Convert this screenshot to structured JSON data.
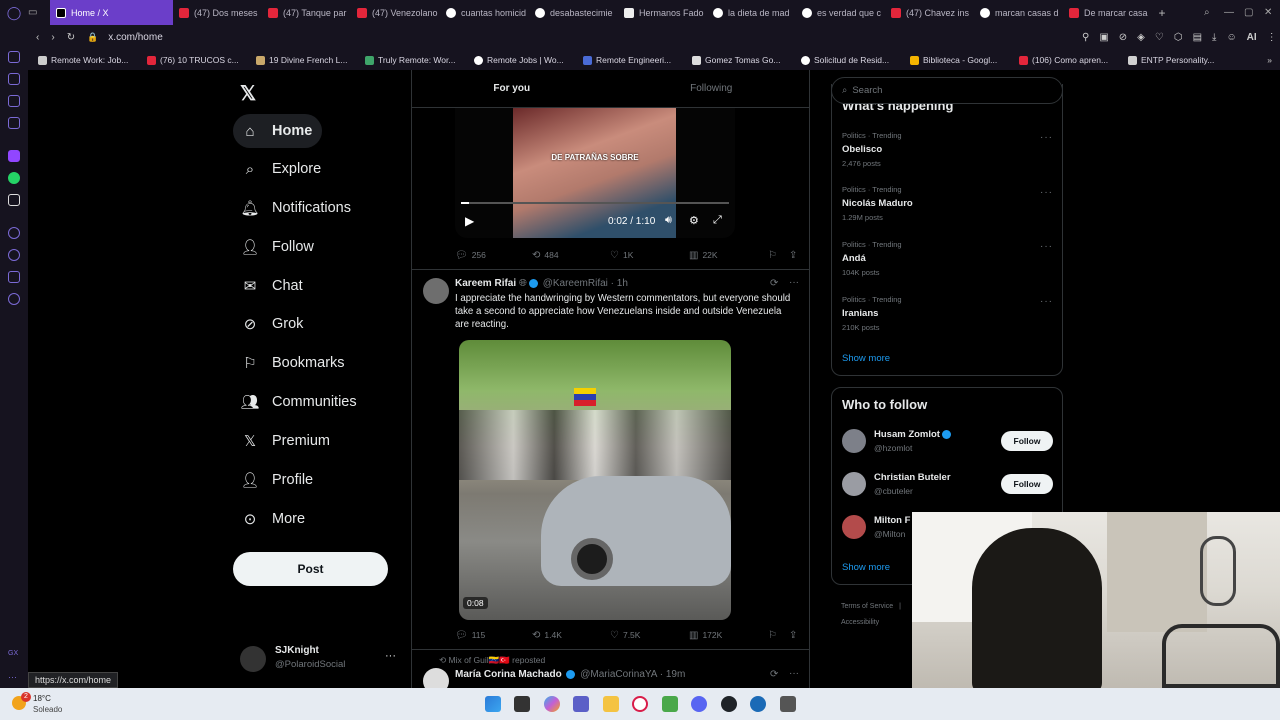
{
  "browser": {
    "tabs": [
      {
        "label": "Home / X",
        "favicon": "x"
      },
      {
        "label": "(47) Dos meses",
        "favicon": "yt"
      },
      {
        "label": "(47) Tanque par",
        "favicon": "yt"
      },
      {
        "label": "(47) Venezolano",
        "favicon": "yt"
      },
      {
        "label": "cuantas homicid",
        "favicon": "g"
      },
      {
        "label": "desabastecimie",
        "favicon": "g"
      },
      {
        "label": "Hermanos Fado",
        "favicon": "w"
      },
      {
        "label": "la dieta de mad",
        "favicon": "g"
      },
      {
        "label": "es verdad que c",
        "favicon": "g"
      },
      {
        "label": "(47) Chavez ins",
        "favicon": "yt"
      },
      {
        "label": "marcan casas d",
        "favicon": "g"
      },
      {
        "label": "De marcar casa",
        "favicon": "yt"
      }
    ],
    "new_tab": "+",
    "url": "x.com/home",
    "ai_label": "AI",
    "bookmarks": [
      "Remote Work: Job...",
      "(76) 10 TRUCOS c...",
      "19 Divine French L...",
      "Truly Remote: Wor...",
      "Remote Jobs | Wo...",
      "Remote Engineeri...",
      "Gomez Tomas Go...",
      "Solicitud de Resid...",
      "Biblioteca - Googl...",
      "(106) Como apren...",
      "ENTP Personality..."
    ],
    "status_url": "https://x.com/home"
  },
  "nav": {
    "items": [
      {
        "label": "Home",
        "icon": "home-icon"
      },
      {
        "label": "Explore",
        "icon": "search-icon"
      },
      {
        "label": "Notifications",
        "icon": "bell-icon"
      },
      {
        "label": "Follow",
        "icon": "person-add-icon"
      },
      {
        "label": "Chat",
        "icon": "mail-icon"
      },
      {
        "label": "Grok",
        "icon": "grok-icon"
      },
      {
        "label": "Bookmarks",
        "icon": "bookmark-icon"
      },
      {
        "label": "Communities",
        "icon": "communities-icon"
      },
      {
        "label": "Premium",
        "icon": "x-logo-icon"
      },
      {
        "label": "Profile",
        "icon": "person-icon"
      },
      {
        "label": "More",
        "icon": "more-circle-icon"
      }
    ],
    "post_label": "Post",
    "account": {
      "name": "SJKnight",
      "handle": "@PolaroidSocial"
    }
  },
  "feed": {
    "tabs": [
      "For you",
      "Following"
    ],
    "post1": {
      "caption": "DE PATRAÑAS SOBRE",
      "time": "0:02 / 1:10",
      "stats": {
        "replies": "256",
        "reposts": "484",
        "likes": "1K",
        "views": "22K"
      }
    },
    "post2": {
      "name": "Kareem Rifai",
      "handle": "@KareemRifai",
      "age": "· 1h",
      "text": "I appreciate the handwringing by Western commentators, but everyone should take a second to appreciate how Venezuelans inside and outside Venezuela are reacting.",
      "video_time": "0:08",
      "stats": {
        "replies": "115",
        "reposts": "1.4K",
        "likes": "7.5K",
        "views": "172K"
      }
    },
    "post3": {
      "repost_line": "Mix of Guil🇻🇪🇹🇷 reposted",
      "name": "María Corina Machado",
      "handle": "@MariaCorinaYA",
      "age": "· 19m"
    }
  },
  "right": {
    "search_placeholder": "Search",
    "section_title": "What's happening",
    "trends": [
      {
        "category": "Politics · Trending",
        "name": "Obelisco",
        "count": "2,476 posts"
      },
      {
        "category": "Politics · Trending",
        "name": "Nicolás Maduro",
        "count": "1.29M posts"
      },
      {
        "category": "Politics · Trending",
        "name": "Andá",
        "count": "104K posts"
      },
      {
        "category": "Politics · Trending",
        "name": "Iranians",
        "count": "210K posts"
      }
    ],
    "show_more": "Show more",
    "who_to_follow": "Who to follow",
    "suggestions": [
      {
        "name": "Husam Zomlot",
        "handle": "@hzomlot"
      },
      {
        "name": "Christian Buteler",
        "handle": "@cbuteler"
      },
      {
        "name": "Milton F",
        "handle": "@Milton"
      }
    ],
    "follow_label": "Follow",
    "show_more_2": "Show more",
    "footer": [
      "Terms of Service",
      "Accessibility"
    ]
  },
  "taskbar": {
    "weather_temp": "18°C",
    "weather_text": "Soleado",
    "weather_badge": "2"
  }
}
